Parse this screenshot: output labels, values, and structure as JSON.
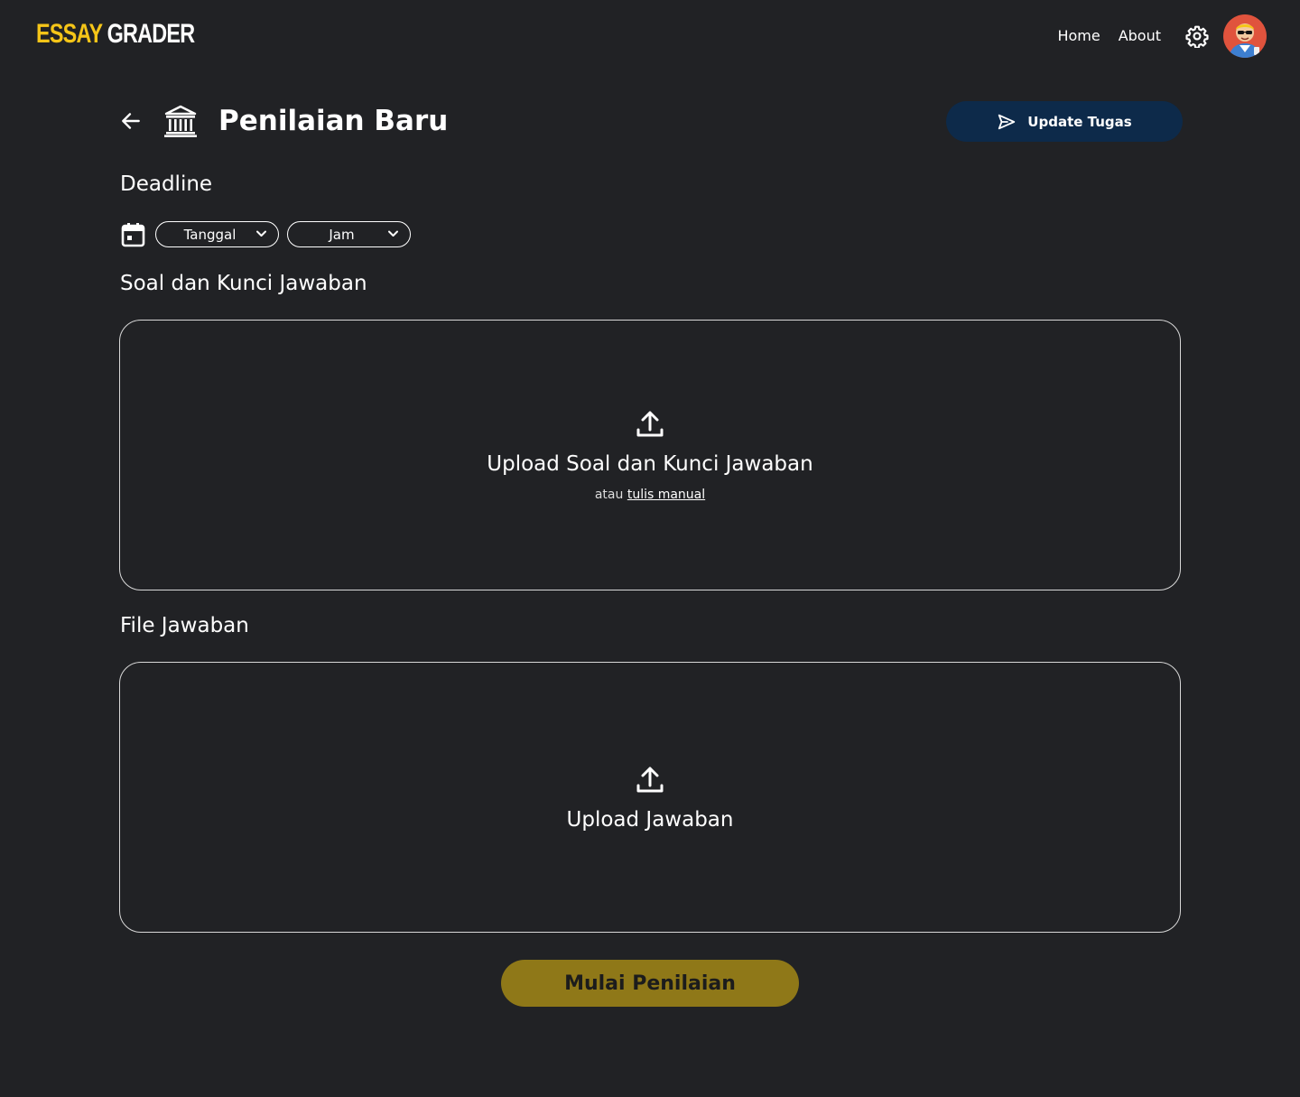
{
  "app": {
    "logo_part1": "ESSAY",
    "logo_part2": "GRADER",
    "logo_color": "#f5c518"
  },
  "nav": {
    "links": [
      {
        "label": "Home"
      },
      {
        "label": "About"
      }
    ],
    "settings_icon": "gear-icon",
    "avatar_icon": "user-avatar"
  },
  "header": {
    "back_icon": "arrow-left-icon",
    "page_icon": "institution-icon",
    "title": "Penilaian Baru",
    "update_button": {
      "label": "Update Tugas",
      "icon": "send-icon",
      "color": "#0d2a4a"
    }
  },
  "deadline": {
    "label": "Deadline",
    "icon": "calendar-icon",
    "date_select": {
      "value": "Tanggal"
    },
    "time_select": {
      "value": "Jam"
    }
  },
  "questions": {
    "label": "Soal dan Kunci Jawaban",
    "upload": {
      "icon": "upload-icon",
      "title": "Upload Soal dan Kunci Jawaban",
      "alt_prefix": "atau",
      "alt_link": "tulis manual"
    }
  },
  "answers": {
    "label": "File Jawaban",
    "upload": {
      "icon": "upload-icon",
      "title": "Upload Jawaban"
    }
  },
  "start_button": {
    "label": "Mulai Penilaian",
    "color": "#8f7818"
  }
}
